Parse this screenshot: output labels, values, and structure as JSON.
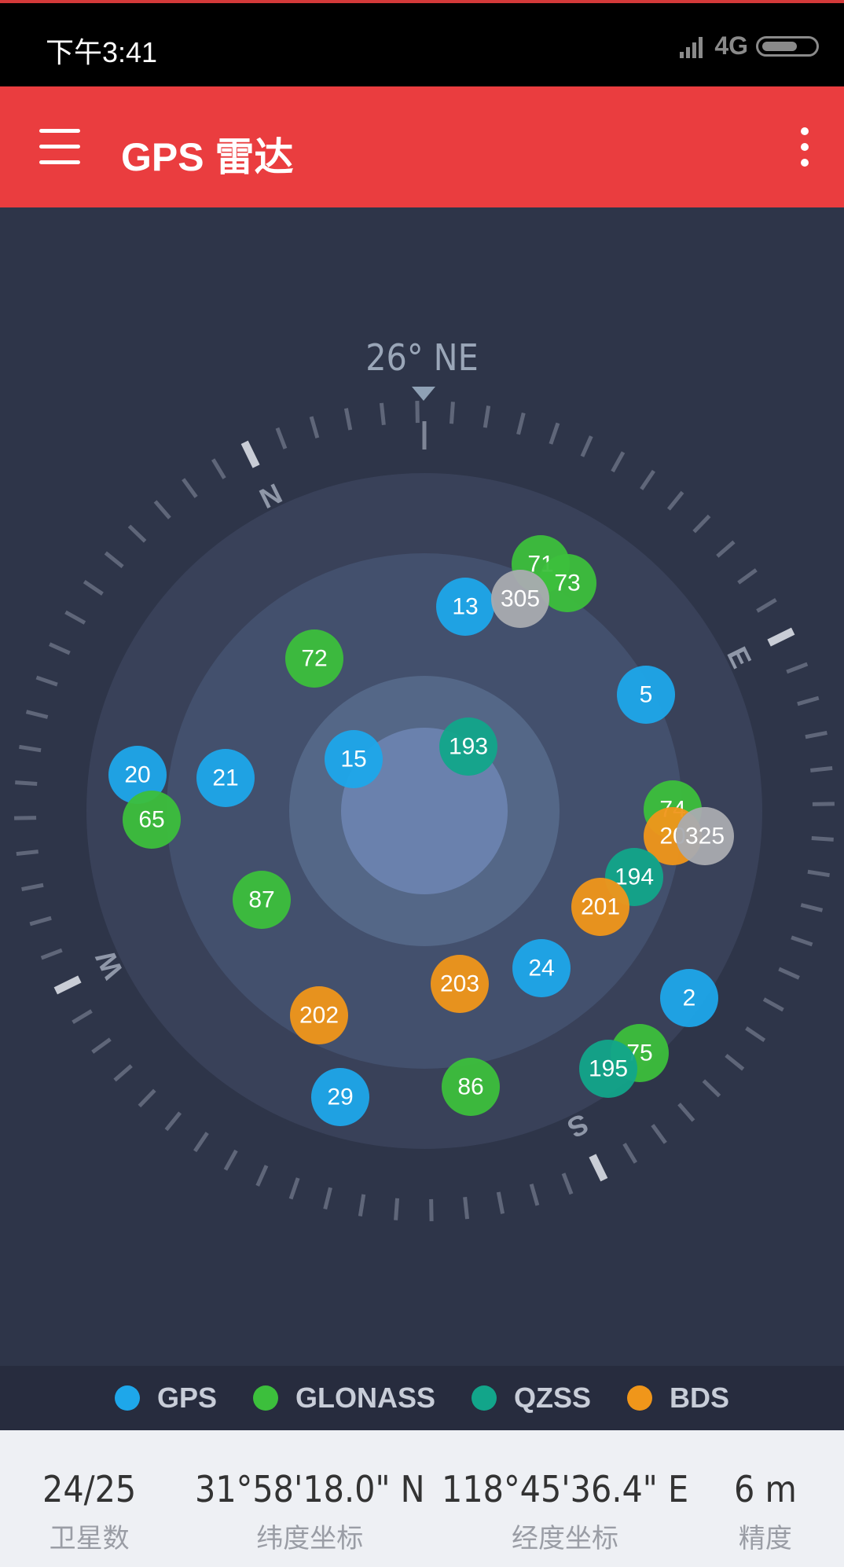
{
  "status_bar": {
    "time": "下午3:41",
    "network": "4G"
  },
  "app_bar": {
    "title": "GPS 雷达"
  },
  "compass": {
    "heading": "26° NE",
    "cardinals": [
      "N",
      "E",
      "S",
      "W"
    ]
  },
  "satellites": [
    {
      "id": "71",
      "system": "GLONASS"
    },
    {
      "id": "73",
      "system": "GLONASS"
    },
    {
      "id": "13",
      "system": "GPS"
    },
    {
      "id": "305",
      "system": "other"
    },
    {
      "id": "72",
      "system": "GLONASS"
    },
    {
      "id": "5",
      "system": "GPS"
    },
    {
      "id": "193",
      "system": "QZSS"
    },
    {
      "id": "15",
      "system": "GPS"
    },
    {
      "id": "20",
      "system": "GPS"
    },
    {
      "id": "21",
      "system": "GPS"
    },
    {
      "id": "65",
      "system": "GLONASS"
    },
    {
      "id": "74",
      "system": "GLONASS"
    },
    {
      "id": "20",
      "system": "BDS"
    },
    {
      "id": "325",
      "system": "other"
    },
    {
      "id": "194",
      "system": "QZSS"
    },
    {
      "id": "201",
      "system": "BDS"
    },
    {
      "id": "87",
      "system": "GLONASS"
    },
    {
      "id": "24",
      "system": "GPS"
    },
    {
      "id": "203",
      "system": "BDS"
    },
    {
      "id": "202",
      "system": "BDS"
    },
    {
      "id": "2",
      "system": "GPS"
    },
    {
      "id": "75",
      "system": "GLONASS"
    },
    {
      "id": "195",
      "system": "QZSS"
    },
    {
      "id": "29",
      "system": "GPS"
    },
    {
      "id": "86",
      "system": "GLONASS"
    }
  ],
  "legend": [
    {
      "label": "GPS",
      "color": "#1ea7ea"
    },
    {
      "label": "GLONASS",
      "color": "#3cbf3c"
    },
    {
      "label": "QZSS",
      "color": "#12a58a"
    },
    {
      "label": "BDS",
      "color": "#f0961a"
    }
  ],
  "colors": {
    "GPS": "#1ea7ea",
    "GLONASS": "#3cbf3c",
    "QZSS": "#12a58a",
    "BDS": "#f0961a",
    "other": "#a9abb0"
  },
  "footer": {
    "satellites_value": "24/25",
    "satellites_label": "卫星数",
    "latitude_value": "31°58'18.0\" N",
    "latitude_label": "纬度坐标",
    "longitude_value": "118°45'36.4\" E",
    "longitude_label": "经度坐标",
    "accuracy_value": "6 m",
    "accuracy_label": "精度"
  }
}
